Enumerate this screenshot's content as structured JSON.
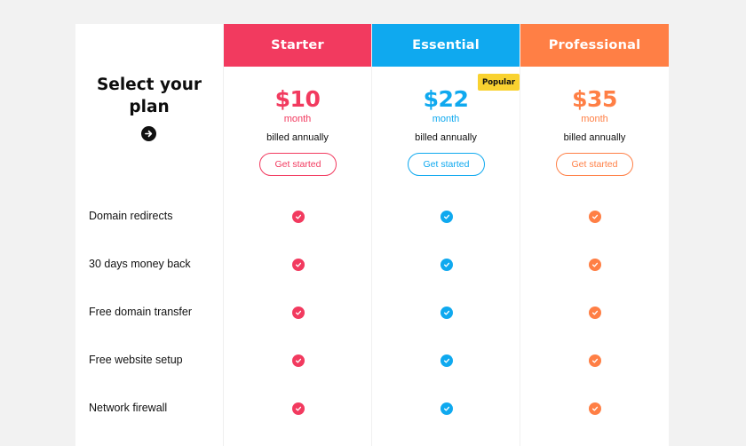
{
  "intro": {
    "title_line1": "Select your",
    "title_line2": "plan"
  },
  "plans": [
    {
      "name": "Starter",
      "price": "$10",
      "period": "month",
      "billing": "billed annually",
      "cta": "Get started",
      "color": "#f23a5f",
      "included": [
        true,
        true,
        true,
        true,
        true
      ]
    },
    {
      "name": "Essential",
      "price": "$22",
      "period": "month",
      "billing": "billed annually",
      "cta": "Get started",
      "color": "#0fa9ef",
      "badge": "Popular",
      "included": [
        true,
        true,
        true,
        true,
        true
      ]
    },
    {
      "name": "Professional",
      "price": "$35",
      "period": "month",
      "billing": "billed annually",
      "cta": "Get started",
      "color": "#ff7f45",
      "included": [
        true,
        true,
        true,
        true,
        true
      ]
    }
  ],
  "features": [
    "Domain redirects",
    "30 days money back",
    "Free domain transfer",
    "Free website setup",
    "Network firewall"
  ],
  "icons": {
    "intro_button": "arrow-right-icon",
    "feature_mark": "check-icon"
  }
}
